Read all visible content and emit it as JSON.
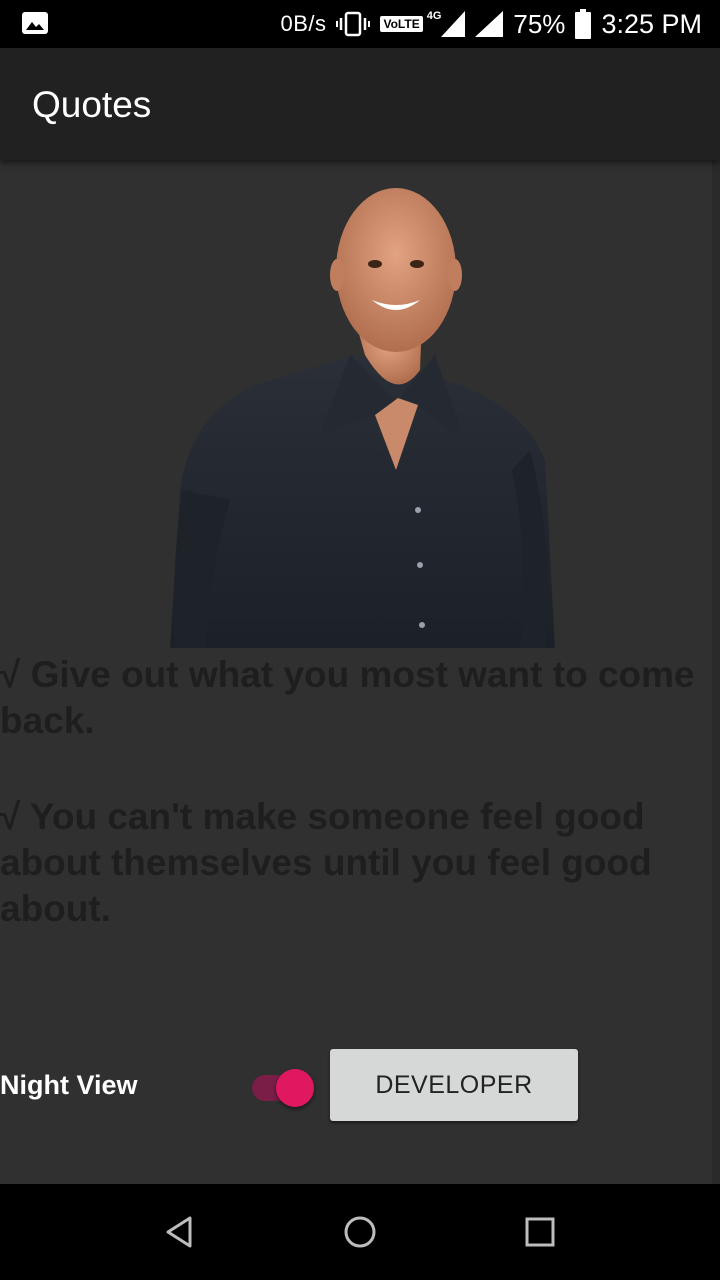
{
  "status_bar": {
    "data_speed": "0B/s",
    "volte": "VoLTE",
    "network": "4G",
    "battery": "75%",
    "time": "3:25 PM",
    "icons": [
      "image-notification-icon",
      "vibrate-icon",
      "signal-icon",
      "battery-icon"
    ]
  },
  "app_bar": {
    "title": "Quotes"
  },
  "content": {
    "portrait_alt": "portrait-photo",
    "quotes": [
      "√ Give out what you most want to come back.",
      "√ You can't make someone feel good about themselves until you feel good about."
    ],
    "night_view_label": "Night View",
    "night_view_on": true,
    "developer_button": "DEVELOPER"
  },
  "nav_bar": {
    "icons": [
      "back-icon",
      "home-icon",
      "recents-icon"
    ]
  },
  "colors": {
    "background": "#303030",
    "app_bar": "#212121",
    "accent": "#e0185f",
    "quote_text": "#1e1e1e"
  }
}
